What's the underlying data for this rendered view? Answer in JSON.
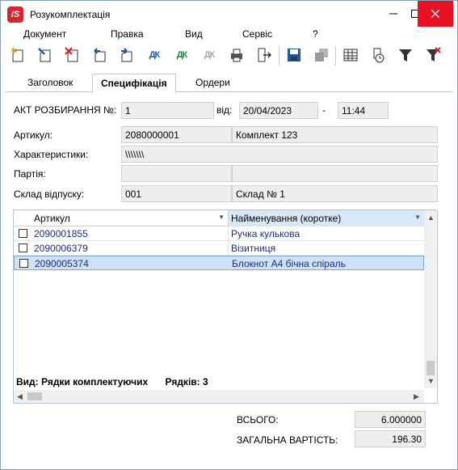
{
  "window": {
    "logo_text": "IS",
    "title": "Розукомплектація"
  },
  "menu": [
    "Документ",
    "Правка",
    "Вид",
    "Сервіс",
    "?"
  ],
  "toolbar": {
    "icons": [
      "new-doc-icon",
      "edit-doc-icon",
      "delete-doc-icon",
      "undo-doc-icon",
      "redo-doc-icon",
      "dk-icon",
      "dk-green-icon",
      "dk-disabled-icon",
      "print-icon",
      "export-icon",
      "save-icon",
      "copy-disabled-icon",
      "table-icon",
      "clock-doc-icon",
      "filter-icon",
      "clear-filter-icon"
    ],
    "dk_label": "ДК"
  },
  "tabs": [
    "Заголовок",
    "Специфікація",
    "Ордери"
  ],
  "active_tab": "Специфікація",
  "form": {
    "act_label": "АКТ РОЗБИРАННЯ №:",
    "act_number": "1",
    "date_label": "від:",
    "date": "20/04/2023",
    "dash": "-",
    "time": "11:44",
    "article_label": "Артикул:",
    "article_code": "2080000001",
    "article_name": "Комплект 123",
    "characteristics_label": "Характеристики:",
    "characteristics_value": "\\\\\\\\\\\\\\",
    "batch_label": "Партія:",
    "batch_code": "",
    "batch_name": "",
    "warehouse_label": "Склад відпуску:",
    "warehouse_code": "001",
    "warehouse_name": "Склад № 1"
  },
  "grid": {
    "columns": [
      "Артикул",
      "Найменування (коротке)"
    ],
    "rows": [
      {
        "article": "2090001855",
        "name": "Ручка кулькова"
      },
      {
        "article": "2090006379",
        "name": "Візитниця"
      },
      {
        "article": "2090005374",
        "name": "Блокнот А4 бічна спіраль"
      }
    ],
    "selected_row": 2,
    "footer_view": "Вид: Рядки комплектуючих",
    "footer_rows": "Рядків: 3"
  },
  "totals": {
    "total_label": "ВСЬОГО:",
    "total_value": "6.000000",
    "cost_label": "ЗАГАЛЬНА ВАРТІСТЬ:",
    "cost_value": "196.30"
  }
}
